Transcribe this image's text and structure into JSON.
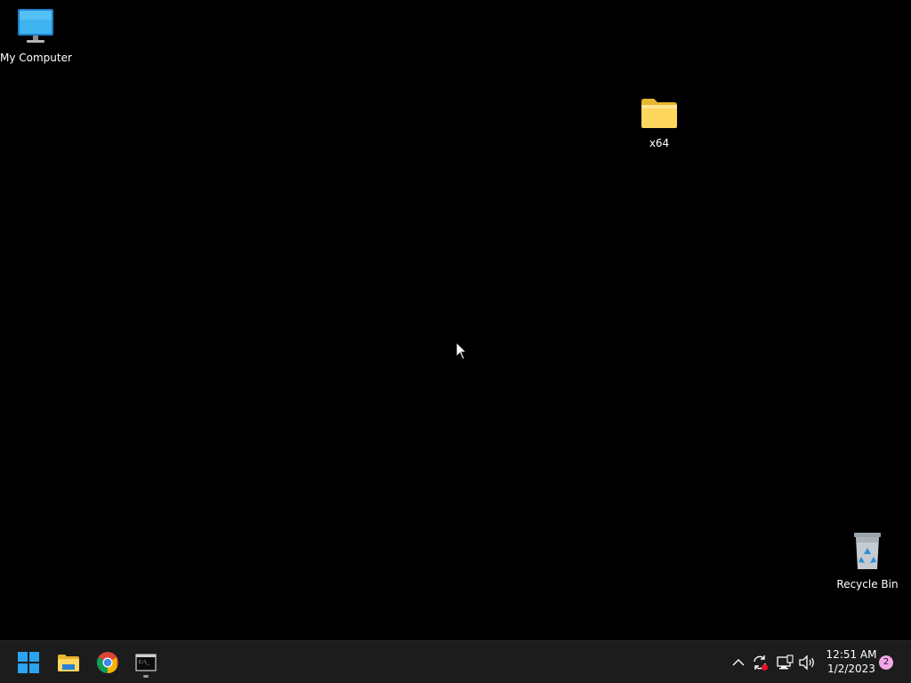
{
  "desktop": {
    "background_color": "#000000",
    "icons": [
      {
        "label": "My Computer",
        "icon": "monitor-icon"
      },
      {
        "label": "x64",
        "icon": "folder-icon"
      },
      {
        "label": "Recycle Bin",
        "icon": "recycle-bin-icon"
      }
    ]
  },
  "taskbar": {
    "background_color": "#1c1c1c",
    "apps": [
      {
        "name": "start",
        "icon": "windows-logo-icon"
      },
      {
        "name": "file-explorer",
        "icon": "folder-icon"
      },
      {
        "name": "chrome",
        "icon": "chrome-icon"
      },
      {
        "name": "terminal",
        "icon": "terminal-icon",
        "running": true
      }
    ],
    "tray": {
      "icons": [
        "chevron-up-icon",
        "sync-icon",
        "network-icon",
        "volume-icon"
      ],
      "time": "12:51 AM",
      "date": "1/2/2023",
      "notification_count": "2"
    }
  }
}
